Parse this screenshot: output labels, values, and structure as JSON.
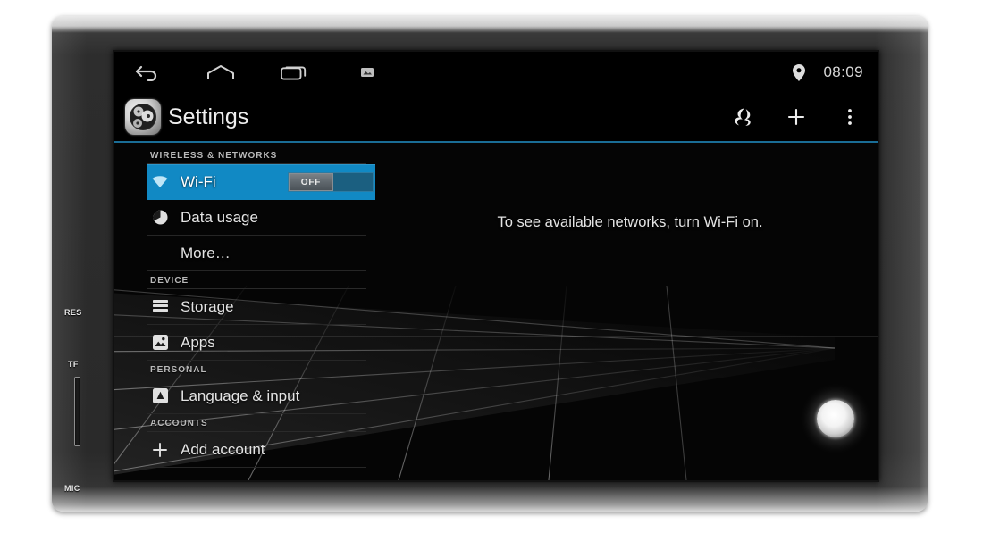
{
  "device": {
    "bezel_labels": [
      {
        "id": "res",
        "text": "RES"
      },
      {
        "id": "tf",
        "text": "TF"
      },
      {
        "id": "mic",
        "text": "MIC"
      }
    ],
    "accent_color": "#1189c4",
    "screen_background": "#050505"
  },
  "status_bar": {
    "nav_icons": [
      "back-icon",
      "home-icon",
      "recents-icon",
      "screenshot-icon"
    ],
    "location_icon": "location-pin-icon",
    "clock": "08:09"
  },
  "action_bar": {
    "app_icon": "settings-gear-icon",
    "title": "Settings",
    "actions": [
      {
        "id": "sync",
        "icon": "sync-icon"
      },
      {
        "id": "add",
        "icon": "plus-icon"
      },
      {
        "id": "overflow",
        "icon": "overflow-menu-icon"
      }
    ]
  },
  "settings_list": [
    {
      "type": "header",
      "label": "WIRELESS & NETWORKS"
    },
    {
      "type": "row",
      "id": "wifi",
      "icon": "wifi-icon",
      "label": "Wi-Fi",
      "selected": true,
      "toggle": {
        "label": "OFF",
        "state": "off"
      }
    },
    {
      "type": "row",
      "id": "data-usage",
      "icon": "data-usage-icon",
      "label": "Data usage",
      "selected": false
    },
    {
      "type": "row",
      "id": "more",
      "icon": "",
      "label": "More…",
      "selected": false,
      "indent": true
    },
    {
      "type": "header",
      "label": "DEVICE"
    },
    {
      "type": "row",
      "id": "storage",
      "icon": "storage-icon",
      "label": "Storage",
      "selected": false
    },
    {
      "type": "row",
      "id": "apps",
      "icon": "apps-icon",
      "label": "Apps",
      "selected": false
    },
    {
      "type": "header",
      "label": "PERSONAL"
    },
    {
      "type": "row",
      "id": "language-input",
      "icon": "language-input-icon",
      "label": "Language & input",
      "selected": false
    },
    {
      "type": "header",
      "label": "ACCOUNTS"
    },
    {
      "type": "row",
      "id": "add-account",
      "icon": "plus-icon",
      "label": "Add account",
      "selected": false
    }
  ],
  "detail_pane": {
    "empty_message": "To see available networks, turn Wi-Fi on."
  }
}
